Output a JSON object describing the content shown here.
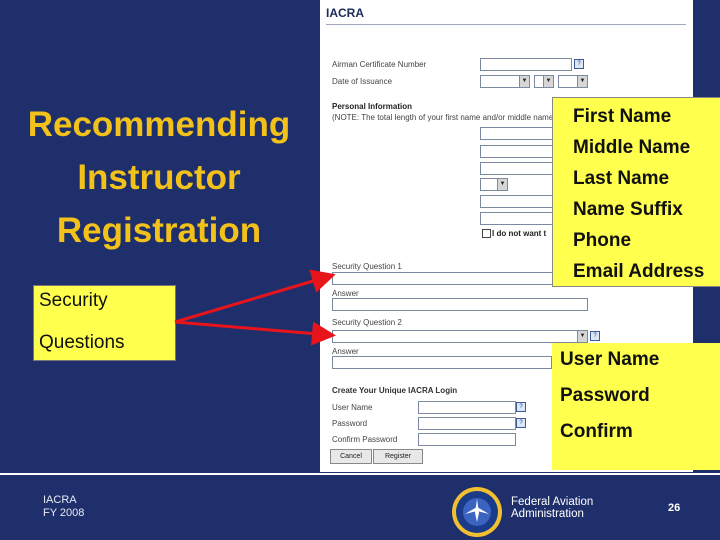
{
  "slide": {
    "title_lines": [
      "Recommending",
      "Instructor",
      "Registration"
    ],
    "security_callout_lines": [
      "Security",
      "Questions"
    ],
    "footer_left_lines": [
      "IACRA",
      "FY 2008"
    ],
    "footer_org_lines": [
      "Federal Aviation",
      "Administration"
    ],
    "page_number": "26"
  },
  "form": {
    "header": "IACRA",
    "personal_information_heading": "Personal Information",
    "do_not_want_label": "I do not want t",
    "security_question_1_label": "Security Question 1",
    "answer_label": "Answer",
    "security_question_2_label": "Security Question 2",
    "create_login_heading": "Create Your Unique IACRA Login",
    "username_label": "User Name",
    "password_label": "Password",
    "confirm_password_label": "Confirm Password",
    "cancel_button": "Cancel",
    "register_button": "Register"
  },
  "personal_callout": {
    "items": [
      "First Name",
      "Middle Name",
      "Last Name",
      "Name Suffix",
      "Phone",
      "Email Address"
    ]
  },
  "login_callout": {
    "items": [
      "User Name",
      "Password",
      "Confirm"
    ]
  },
  "colors": {
    "background": "#1f2f6b",
    "title": "#f2c21a",
    "callout": "#ffff4d",
    "arrow": "#e8141b"
  }
}
